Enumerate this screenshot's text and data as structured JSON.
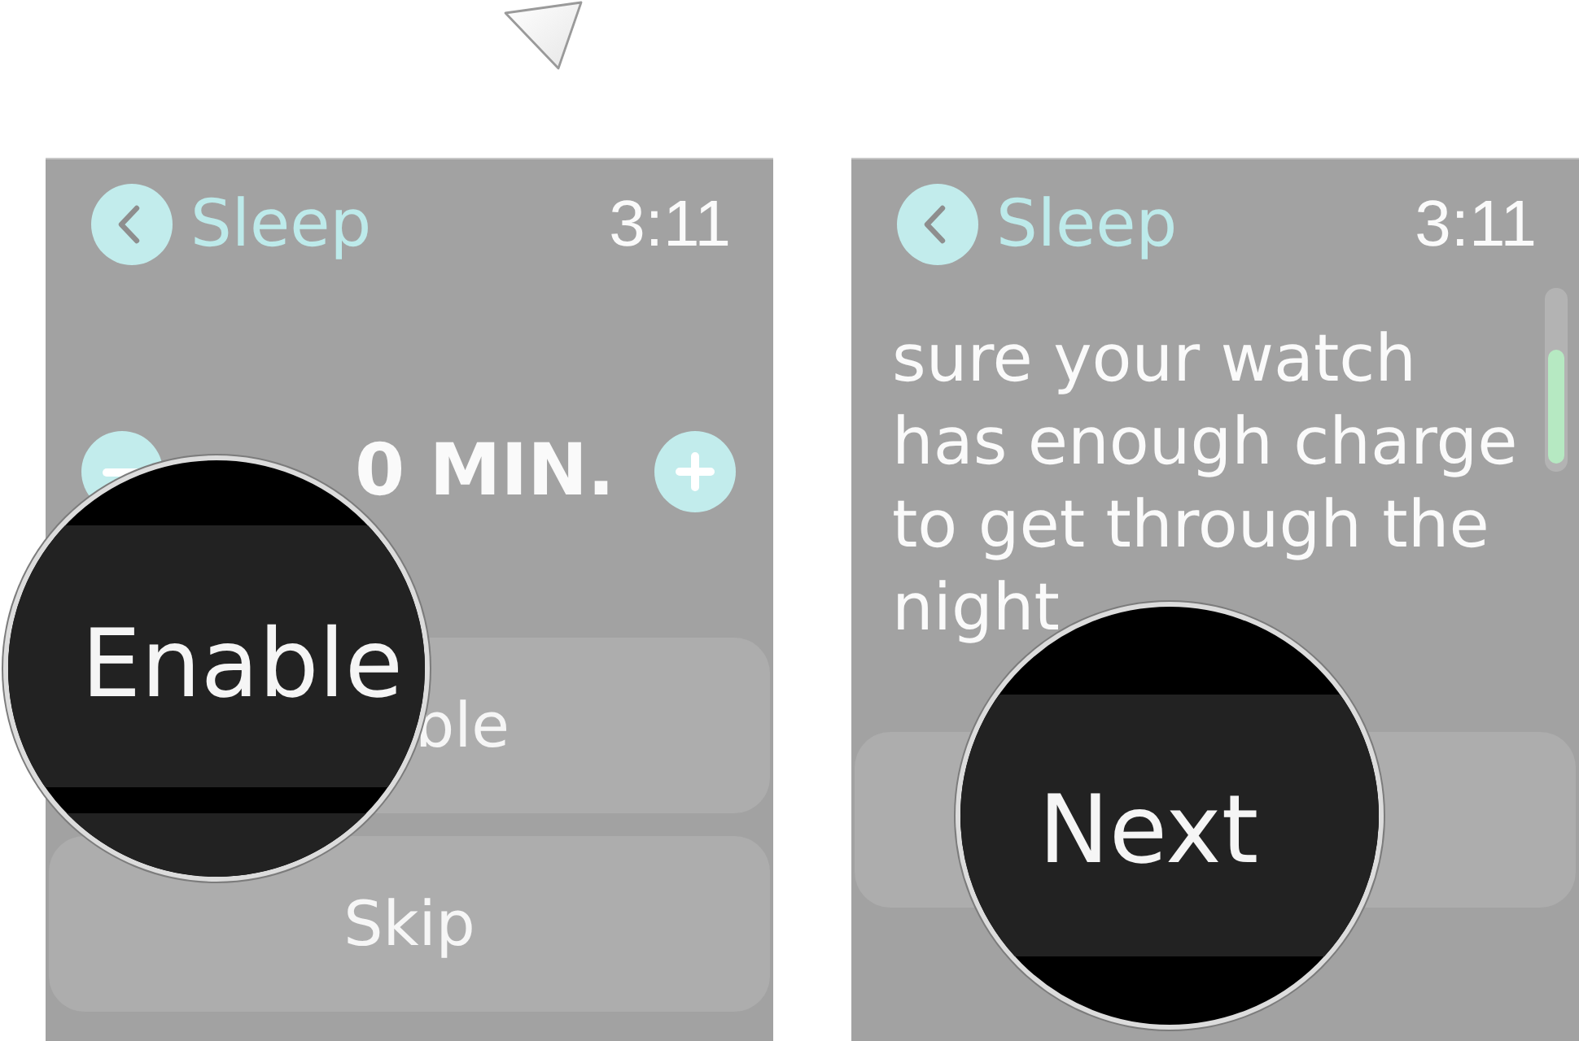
{
  "screens": [
    {
      "kind": "duration",
      "title": "Sleep",
      "time": "3:11",
      "duration": "0 MIN.",
      "buttons": [
        {
          "label": "ble",
          "covered": true
        },
        {
          "label": "Skip",
          "covered": false
        }
      ],
      "magnifier": {
        "label": "Enable"
      }
    },
    {
      "kind": "message",
      "title": "Sleep",
      "time": "3:11",
      "body": "sure your watch has enough charge to get through the night",
      "magnifier": {
        "label": "Next"
      }
    }
  ]
}
